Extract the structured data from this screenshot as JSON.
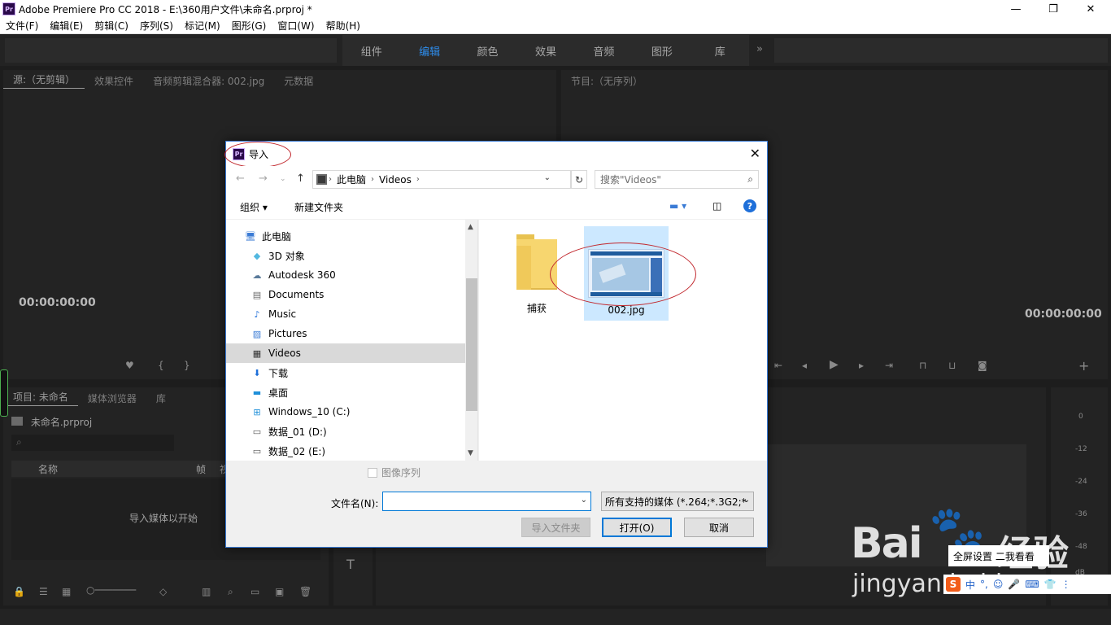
{
  "app": {
    "title": "Adobe Premiere Pro CC 2018 - E:\\360用户文件\\未命名.prproj *",
    "logo": "Pr"
  },
  "window_controls": {
    "minimize": "—",
    "maximize": "❐",
    "close": "✕"
  },
  "menu": [
    "文件(F)",
    "编辑(E)",
    "剪辑(C)",
    "序列(S)",
    "标记(M)",
    "图形(G)",
    "窗口(W)",
    "帮助(H)"
  ],
  "workspaces": {
    "items": [
      "组件",
      "编辑",
      "颜色",
      "效果",
      "音频",
      "图形",
      "库"
    ],
    "active": "编辑",
    "overflow": "»"
  },
  "source_panel": {
    "tabs": [
      "源:（无剪辑）",
      "效果控件",
      "音频剪辑混合器: 002.jpg",
      "元数据"
    ],
    "timecode": "00:00:00:00"
  },
  "program_panel": {
    "tabs": [
      "节目:（无序列）"
    ],
    "timecode": "00:00:00:00"
  },
  "project_panel": {
    "tabs": [
      "项目: 未命名",
      "媒体浏览器",
      "库"
    ],
    "project_file": "未命名.prproj",
    "column_name": "名称",
    "column_rate": "帧",
    "column_extra": "视",
    "empty_text": "导入媒体以开始"
  },
  "audio_meter": {
    "scale": [
      "0",
      "-12",
      "-24",
      "-36",
      "-48",
      "dB"
    ]
  },
  "dialog": {
    "title": "导入",
    "close": "✕",
    "address": {
      "segments": [
        "此电脑",
        "Videos"
      ]
    },
    "search_placeholder": "搜索\"Videos\"",
    "organize": "组织 ▾",
    "new_folder": "新建文件夹",
    "nav_items": [
      {
        "label": "此电脑",
        "icon": "computer-icon"
      },
      {
        "label": "3D 对象",
        "icon": "cube-icon"
      },
      {
        "label": "Autodesk 360",
        "icon": "cloud-icon"
      },
      {
        "label": "Documents",
        "icon": "document-icon"
      },
      {
        "label": "Music",
        "icon": "music-icon"
      },
      {
        "label": "Pictures",
        "icon": "picture-icon"
      },
      {
        "label": "Videos",
        "icon": "film-icon",
        "selected": true
      },
      {
        "label": "下载",
        "icon": "download-icon"
      },
      {
        "label": "桌面",
        "icon": "desktop-icon"
      },
      {
        "label": "Windows_10 (C:)",
        "icon": "windows-drive-icon"
      },
      {
        "label": "数据_01 (D:)",
        "icon": "drive-icon"
      },
      {
        "label": "数据_02 (E:)",
        "icon": "drive-icon"
      }
    ],
    "files": [
      {
        "name": "捕获",
        "type": "folder"
      },
      {
        "name": "002.jpg",
        "type": "image",
        "selected": true
      }
    ],
    "image_sequence": "图像序列",
    "filename_label": "文件名(N):",
    "filename_value": "",
    "filetype": "所有支持的媒体 (*.264;*.3G2;*",
    "import_folder": "导入文件夹",
    "open": "打开(O)",
    "cancel": "取消"
  },
  "watermark": {
    "brand": "Bai",
    "paw": "🐾",
    "cn": "经验",
    "site": "jingyan.baidu.com"
  },
  "floating_button": "全屏设置 二我看看",
  "ime": [
    "S",
    "中",
    "°,",
    "☺",
    "🎤",
    "⌨",
    "👕",
    "⋮"
  ],
  "colors": {
    "accent": "#2d8ceb",
    "annotation": "#c1272d",
    "dialog_border": "#3a7bd5"
  }
}
